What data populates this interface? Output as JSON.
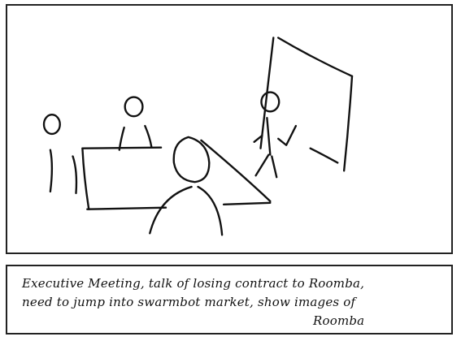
{
  "scene": {
    "description_label": "",
    "caption_lines": [
      "Executive Meeting, talk of losing contract to Roomba,",
      "need to jump into swarmbot market, show images of",
      "Roomba"
    ]
  },
  "colors": {
    "ink": "#111111",
    "paper": "#ffffff",
    "border": "#222222"
  },
  "icons": {
    "sketch": "meeting-room-sketch"
  }
}
